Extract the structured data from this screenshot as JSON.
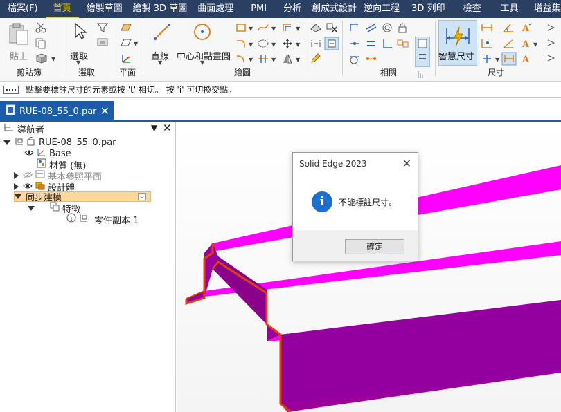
{
  "menu": {
    "items": [
      "檔案(F)",
      "首頁",
      "繪製草圖",
      "繪製 3D 草圖",
      "曲面處理",
      "PMI",
      "分析",
      "創成式設計",
      "逆向工程",
      "3D 列印",
      "檢查",
      "工具",
      "增益集"
    ]
  },
  "ribbon": {
    "clipboard": {
      "paste_label": "貼上",
      "group_label": "剪貼簿"
    },
    "select": {
      "select_label": "選取",
      "group_label": "選取"
    },
    "plane": {
      "group_label": "平面"
    },
    "draw": {
      "line_label": "直線",
      "circle_label": "中心和點畫圓",
      "group_label": "繪圖"
    },
    "relate": {
      "group_label": "相關"
    },
    "dimension": {
      "smart_label": "智慧尺寸",
      "group_label": "尺寸"
    }
  },
  "prompt": {
    "text": "點擊要標註尺寸的元素或按 't' 相切。 按 'i' 可切換交點。"
  },
  "document_tab": {
    "name": "RUE-08_55_0.par",
    "close": "✕"
  },
  "navigator": {
    "title": "導航者",
    "items": {
      "root": "RUE-08_55_0.par",
      "base": "Base",
      "material": "材質 (無)",
      "ref_planes": "基本參照平面",
      "design_body": "設計體",
      "sync": "同步建模",
      "features": "特徵",
      "part_copy": "零件副本 1"
    }
  },
  "dialog": {
    "title": "Solid Edge 2023",
    "message": "不能標註尺寸。",
    "ok_label": "確定",
    "info_glyph": "i",
    "close": "✕"
  },
  "colors": {
    "menubar": "#2b3f63",
    "accent": "#f0d000",
    "tab": "#1a5da8",
    "part_top": "#ff00ff",
    "part_side": "#9a009a",
    "part_edge": "#e04010"
  }
}
